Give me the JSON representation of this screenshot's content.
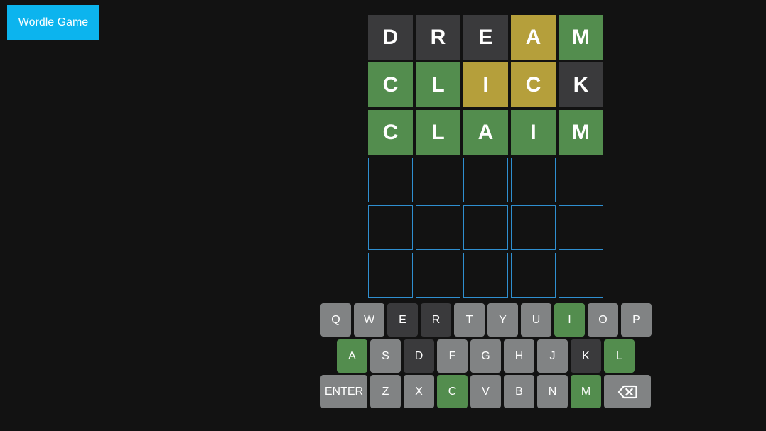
{
  "header": {
    "title_button_label": "Wordle Game"
  },
  "colors": {
    "background": "#121212",
    "accent": "#0cb4ee",
    "tile_absent": "#3a3a3c",
    "tile_present": "#b59f3b",
    "tile_correct": "#538d4e",
    "tile_empty_border": "#2f8fd0",
    "key_default": "#818384"
  },
  "board": {
    "rows": [
      [
        {
          "letter": "D",
          "state": "absent"
        },
        {
          "letter": "R",
          "state": "absent"
        },
        {
          "letter": "E",
          "state": "absent"
        },
        {
          "letter": "A",
          "state": "present"
        },
        {
          "letter": "M",
          "state": "correct"
        }
      ],
      [
        {
          "letter": "C",
          "state": "correct"
        },
        {
          "letter": "L",
          "state": "correct"
        },
        {
          "letter": "I",
          "state": "present"
        },
        {
          "letter": "C",
          "state": "present"
        },
        {
          "letter": "K",
          "state": "absent"
        }
      ],
      [
        {
          "letter": "C",
          "state": "correct"
        },
        {
          "letter": "L",
          "state": "correct"
        },
        {
          "letter": "A",
          "state": "correct"
        },
        {
          "letter": "I",
          "state": "correct"
        },
        {
          "letter": "M",
          "state": "correct"
        }
      ],
      [
        {
          "letter": "",
          "state": "empty"
        },
        {
          "letter": "",
          "state": "empty"
        },
        {
          "letter": "",
          "state": "empty"
        },
        {
          "letter": "",
          "state": "empty"
        },
        {
          "letter": "",
          "state": "empty"
        }
      ],
      [
        {
          "letter": "",
          "state": "empty"
        },
        {
          "letter": "",
          "state": "empty"
        },
        {
          "letter": "",
          "state": "empty"
        },
        {
          "letter": "",
          "state": "empty"
        },
        {
          "letter": "",
          "state": "empty"
        }
      ],
      [
        {
          "letter": "",
          "state": "empty"
        },
        {
          "letter": "",
          "state": "empty"
        },
        {
          "letter": "",
          "state": "empty"
        },
        {
          "letter": "",
          "state": "empty"
        },
        {
          "letter": "",
          "state": "empty"
        }
      ]
    ]
  },
  "keyboard": {
    "rows": [
      [
        {
          "label": "Q",
          "state": "default"
        },
        {
          "label": "W",
          "state": "default"
        },
        {
          "label": "E",
          "state": "absent"
        },
        {
          "label": "R",
          "state": "absent"
        },
        {
          "label": "T",
          "state": "default"
        },
        {
          "label": "Y",
          "state": "default"
        },
        {
          "label": "U",
          "state": "default"
        },
        {
          "label": "I",
          "state": "correct"
        },
        {
          "label": "O",
          "state": "default"
        },
        {
          "label": "P",
          "state": "default"
        }
      ],
      [
        {
          "label": "A",
          "state": "correct"
        },
        {
          "label": "S",
          "state": "default"
        },
        {
          "label": "D",
          "state": "absent"
        },
        {
          "label": "F",
          "state": "default"
        },
        {
          "label": "G",
          "state": "default"
        },
        {
          "label": "H",
          "state": "default"
        },
        {
          "label": "J",
          "state": "default"
        },
        {
          "label": "K",
          "state": "absent"
        },
        {
          "label": "L",
          "state": "correct"
        }
      ],
      [
        {
          "label": "ENTER",
          "state": "default",
          "kind": "enter"
        },
        {
          "label": "Z",
          "state": "default"
        },
        {
          "label": "X",
          "state": "default"
        },
        {
          "label": "C",
          "state": "correct"
        },
        {
          "label": "V",
          "state": "default"
        },
        {
          "label": "B",
          "state": "default"
        },
        {
          "label": "N",
          "state": "default"
        },
        {
          "label": "M",
          "state": "correct"
        },
        {
          "label": "",
          "state": "default",
          "kind": "backspace",
          "icon": "backspace-icon"
        }
      ]
    ]
  }
}
